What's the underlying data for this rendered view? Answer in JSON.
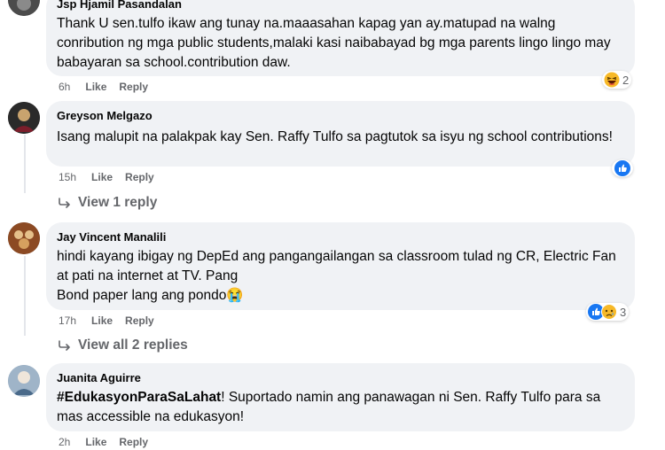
{
  "comments": [
    {
      "author": "Jsp Hjamil Pasandalan",
      "text": "Thank U sen.tulfo ikaw ang tunay na.maaasahan kapag yan ay.matupad na walng conribution ng mga public students,malaki kasi naibabayad bg mga parents lingo lingo may babayaran sa school.contribution daw.",
      "time": "6h",
      "like": "Like",
      "reply": "Reply",
      "reaction_count": "2",
      "reaction_icons": [
        "haha-icon"
      ]
    },
    {
      "author": "Greyson Melgazo",
      "text": "Isang malupit na palakpak kay Sen. Raffy Tulfo sa pagtutok sa isyu ng school contributions!",
      "time": "15h",
      "like": "Like",
      "reply": "Reply",
      "reaction_count": "",
      "reaction_icons": [
        "like-icon"
      ],
      "view_replies": "View 1 reply"
    },
    {
      "author": "Jay Vincent Manalili",
      "text": "hindi kayang ibigay ng DepEd ang pangangailangan sa classroom tulad ng CR, Electric Fan at pati na internet at TV. Pang\nBond paper lang ang pondo😭",
      "time": "17h",
      "like": "Like",
      "reply": "Reply",
      "reaction_count": "3",
      "reaction_icons": [
        "like-icon",
        "sad-icon"
      ],
      "view_replies": "View all 2 replies"
    },
    {
      "author": "Juanita Aguirre",
      "hashtag": "#EdukasyonParaSaLahat",
      "text": "! Suportado namin ang panawagan ni Sen. Raffy Tulfo para sa mas accessible na edukasyon!",
      "time": "2h",
      "like": "Like",
      "reply": "Reply"
    }
  ],
  "colors": {
    "bubble": "#f0f2f5",
    "meta": "#65676b",
    "like_blue": "#1877f2",
    "haha_yellow": "#f7b928"
  }
}
